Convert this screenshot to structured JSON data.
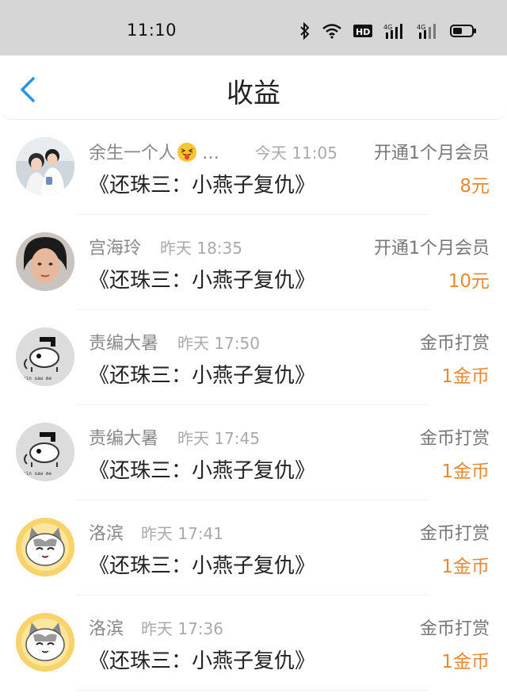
{
  "status_bar": {
    "time": "11:10",
    "battery_color": "#111111"
  },
  "nav": {
    "back_icon": "chevron-left-icon",
    "title": "收益",
    "accent": "#2a93e8"
  },
  "colors": {
    "amount": "#e9892f",
    "name": "#888888",
    "title": "#222222"
  },
  "rows": [
    {
      "avatar": "couple-photo",
      "name": "余生一个人",
      "name_suffix": "…",
      "time": "今天 11:05",
      "type": "开通1个月会员",
      "title": "《还珠三：小燕子复仇》",
      "amount": "8元"
    },
    {
      "avatar": "person-photo",
      "name": "宫海玲",
      "time": "昨天 18:35",
      "type": "开通1个月会员",
      "title": "《还珠三：小燕子复仇》",
      "amount": "10元"
    },
    {
      "avatar": "chain-saw-cartoon",
      "name": "责编大暑",
      "time": "昨天 17:50",
      "type": "金币打赏",
      "title": "《还珠三：小燕子复仇》",
      "amount": "1金币"
    },
    {
      "avatar": "chain-saw-cartoon",
      "name": "责编大暑",
      "time": "昨天 17:45",
      "type": "金币打赏",
      "title": "《还珠三：小燕子复仇》",
      "amount": "1金币"
    },
    {
      "avatar": "cat-cartoon",
      "name": "洛滨",
      "time": "昨天 17:41",
      "type": "金币打赏",
      "title": "《还珠三：小燕子复仇》",
      "amount": "1金币"
    },
    {
      "avatar": "cat-cartoon",
      "name": "洛滨",
      "time": "昨天 17:36",
      "type": "金币打赏",
      "title": "《还珠三：小燕子复仇》",
      "amount": "1金币"
    }
  ]
}
